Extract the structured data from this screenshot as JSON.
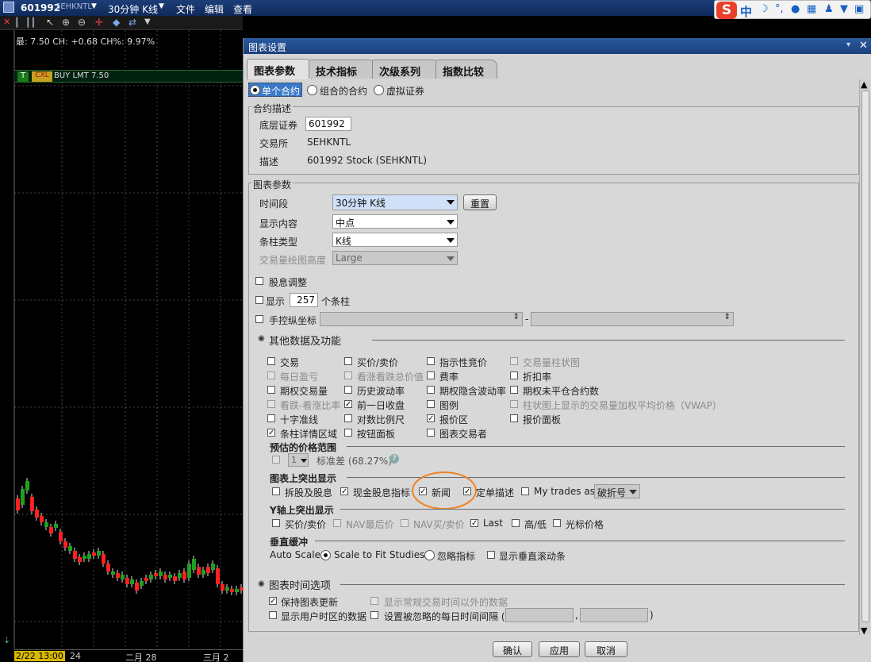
{
  "app": {
    "symbol": "601992",
    "exchange": "SEHKNTL",
    "timeframe": "30分钟 K线",
    "menus": [
      "文件",
      "编辑",
      "查看"
    ]
  },
  "ime": {
    "label": "中"
  },
  "chart": {
    "price_info": "最: 7.50 CH: +0.68 CH%: 9.97%",
    "order_t": "T",
    "order_cxl": "CXL",
    "order_label": "BUY LMT 7.50",
    "dates": [
      "2/22 13:00",
      "24",
      "二月 28",
      "三月 2"
    ]
  },
  "dialog": {
    "title": "图表设置",
    "tabs": [
      "图表参数",
      "技术指标",
      "次级系列",
      "指数比较"
    ],
    "contract_types": [
      "单个合约",
      "组合的合约",
      "虚拟证券"
    ],
    "contract_desc": {
      "legend": "合约描述",
      "underlying_label": "底层证券",
      "underlying_value": "601992",
      "exchange_label": "交易所",
      "exchange_value": "SEHKNTL",
      "desc_label": "描述",
      "desc_value": "601992 Stock (SEHKNTL)"
    },
    "chart_params": {
      "legend": "图表参数",
      "period_label": "时间段",
      "period_value": "30分钟 K线",
      "reset": "重置",
      "content_label": "显示内容",
      "content_value": "中点",
      "bar_label": "条柱类型",
      "bar_value": "K线",
      "volume_label": "交易量绘图高度",
      "volume_value": "Large",
      "dividend": "股息调整",
      "show_label": "显示",
      "show_count": "257",
      "show_unit": "个条柱",
      "manual_axis": "手控纵坐标",
      "range_dash": "-"
    },
    "other": {
      "title": "其他数据及功能",
      "items": [
        {
          "label": "交易",
          "checked": false,
          "disabled": false
        },
        {
          "label": "买价/卖价",
          "checked": false,
          "disabled": false
        },
        {
          "label": "指示性竞价",
          "checked": false,
          "disabled": false
        },
        {
          "label": "交易量柱状图",
          "checked": false,
          "disabled": true
        },
        {
          "label": "每日盈亏",
          "checked": false,
          "disabled": true
        },
        {
          "label": "看涨看跌总价值",
          "checked": false,
          "disabled": true
        },
        {
          "label": "费率",
          "checked": false,
          "disabled": false
        },
        {
          "label": "折扣率",
          "checked": false,
          "disabled": false
        },
        {
          "label": "期权交易量",
          "checked": false,
          "disabled": false
        },
        {
          "label": "历史波动率",
          "checked": false,
          "disabled": false
        },
        {
          "label": "期权隐含波动率",
          "checked": false,
          "disabled": false
        },
        {
          "label": "期权未平仓合约数",
          "checked": false,
          "disabled": false
        },
        {
          "label": "看跌-看涨比率",
          "checked": false,
          "disabled": true
        },
        {
          "label": "前一日收盘",
          "checked": true,
          "disabled": false
        },
        {
          "label": "图例",
          "checked": false,
          "disabled": false
        },
        {
          "label": "柱状图上显示的交易量加权平均价格（VWAP）",
          "checked": false,
          "disabled": true
        },
        {
          "label": "十字准线",
          "checked": false,
          "disabled": false
        },
        {
          "label": "对数比例尺",
          "checked": false,
          "disabled": false
        },
        {
          "label": "报价区",
          "checked": true,
          "disabled": false
        },
        {
          "label": "报价面板",
          "checked": false,
          "disabled": false
        },
        {
          "label": "条柱详情区域",
          "checked": true,
          "disabled": false
        },
        {
          "label": "按钮面板",
          "checked": false,
          "disabled": false
        },
        {
          "label": "图表交易者",
          "checked": false,
          "disabled": false
        }
      ]
    },
    "price_range": {
      "title": "预估的价格范围",
      "value": "1",
      "label": "标准差 (68.27%)"
    },
    "highlight": {
      "title": "图表上突出显示",
      "items": [
        {
          "label": "拆股及股息",
          "checked": false
        },
        {
          "label": "现金股息指标",
          "checked": true
        },
        {
          "label": "新闻",
          "checked": true
        },
        {
          "label": "定单描述",
          "checked": true
        },
        {
          "label": "My trades as",
          "checked": false
        }
      ],
      "trades_value": "破折号"
    },
    "yaxis": {
      "title": "Y轴上突出显示",
      "items": [
        {
          "label": "买价/卖价",
          "checked": false,
          "disabled": false
        },
        {
          "label": "NAV最后价",
          "checked": false,
          "disabled": true
        },
        {
          "label": "NAV买/卖价",
          "checked": false,
          "disabled": true
        },
        {
          "label": "Last",
          "checked": true,
          "disabled": false
        },
        {
          "label": "高/低",
          "checked": false,
          "disabled": false
        },
        {
          "label": "光标价格",
          "checked": false,
          "disabled": false
        }
      ]
    },
    "vbuffer": {
      "title": "垂直缓冲",
      "auto_label": "Auto Scale:",
      "opt1": "Scale to Fit Studies",
      "opt2": "忽略指标",
      "scroll": "显示垂直滚动条"
    },
    "time_options": {
      "title": "图表时间选项",
      "keep_update": "保持图表更新",
      "show_outside": "显示常规交易时间以外的数据",
      "user_tz": "显示用户时区的数据",
      "ignored_interval": "设置被忽略的每日时间间隔 (",
      "comma": ",",
      "close_paren": ")"
    },
    "buttons": {
      "ok": "确认",
      "apply": "应用",
      "cancel": "取消"
    }
  },
  "colors": {
    "accent": "#1c3e78",
    "candle_up": "#ff2020",
    "candle_down": "#20a020",
    "annotation": "#f08020"
  }
}
